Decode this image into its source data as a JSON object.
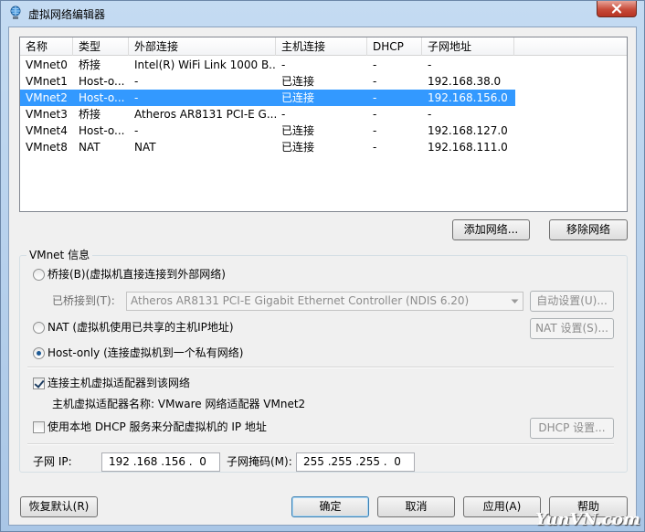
{
  "window": {
    "title": "虚拟网络编辑器"
  },
  "list": {
    "columns": [
      "名称",
      "类型",
      "外部连接",
      "主机连接",
      "DHCP",
      "子网地址"
    ],
    "rows": [
      [
        "VMnet0",
        "桥接",
        "Intel(R) WiFi Link 1000 B...",
        "-",
        "-",
        "-"
      ],
      [
        "VMnet1",
        "Host-o...",
        "-",
        "已连接",
        "-",
        "192.168.38.0"
      ],
      [
        "VMnet2",
        "Host-o...",
        "-",
        "已连接",
        "-",
        "192.168.156.0"
      ],
      [
        "VMnet3",
        "桥接",
        "Atheros AR8131 PCI-E G...",
        "-",
        "-",
        "-"
      ],
      [
        "VMnet4",
        "Host-o...",
        "-",
        "已连接",
        "-",
        "192.168.127.0"
      ],
      [
        "VMnet8",
        "NAT",
        "NAT",
        "已连接",
        "-",
        "192.168.111.0"
      ]
    ],
    "selected_row": 2
  },
  "buttons": {
    "add_network": "添加网络...",
    "remove_network": "移除网络",
    "auto_settings": "自动设置(U)...",
    "nat_settings": "NAT 设置(S)...",
    "dhcp_settings": "DHCP 设置...",
    "restore_defaults": "恢复默认(R)",
    "ok": "确定",
    "cancel": "取消",
    "apply": "应用(A)",
    "help": "帮助"
  },
  "vmnet_info": {
    "title": "VMnet 信息",
    "bridged_label": "桥接(B)(虚拟机直接连接到外部网络)",
    "bridged_to_label": "已桥接到(T):",
    "bridged_to_value": "Atheros AR8131 PCI-E Gigabit Ethernet Controller (NDIS 6.20)",
    "nat_label": "NAT (虚拟机使用已共享的主机IP地址)",
    "hostonly_label": "Host-only (连接虚拟机到一个私有网络)",
    "selected_mode": "Host-only",
    "connect_adapter_label": "连接主机虚拟适配器到该网络",
    "connect_adapter_checked": true,
    "adapter_name_label": "主机虚拟适配器名称: VMware 网络适配器 VMnet2",
    "dhcp_label": "使用本地 DHCP 服务来分配虚拟机的 IP 地址",
    "dhcp_checked": false,
    "subnet_ip_label": "子网 IP:",
    "subnet_ip_value": "192 .168 .156 .  0",
    "subnet_mask_label": "子网掩码(M):",
    "subnet_mask_value": "255 .255 .255 .  0"
  },
  "watermark": "YunVN.com",
  "icons": {
    "app": "network-globe-icon",
    "close": "close-icon",
    "dropdown": "chevron-down-icon"
  },
  "colors": {
    "selection": "#3399ff",
    "close_button": "#c74b3a",
    "title_background": "#b9d1ea"
  }
}
